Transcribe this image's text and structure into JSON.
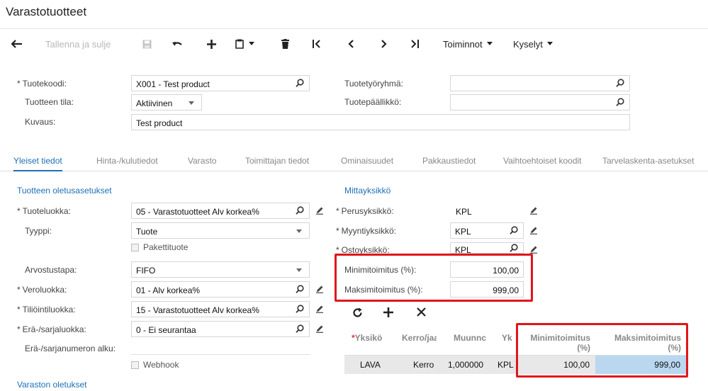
{
  "page_title": "Varastotuotteet",
  "toolbar": {
    "save_close_label": "Tallenna ja sulje",
    "actions_label": "Toiminnot",
    "queries_label": "Kyselyt"
  },
  "header": {
    "product_code_label": "Tuotekoodi:",
    "product_code_value": "X001 - Test product",
    "status_label": "Tuotteen tila:",
    "status_value": "Aktiivinen",
    "description_label": "Kuvaus:",
    "description_value": "Test product",
    "product_group_label": "Tuotetyöryhmä:",
    "product_group_value": "",
    "product_manager_label": "Tuotepäällikkö:",
    "product_manager_value": ""
  },
  "tabs": [
    {
      "label": "Yleiset tiedot",
      "active": true
    },
    {
      "label": "Hinta-/kulutiedot",
      "active": false
    },
    {
      "label": "Varasto",
      "active": false
    },
    {
      "label": "Toimittajan tiedot",
      "active": false
    },
    {
      "label": "Ominaisuudet",
      "active": false
    },
    {
      "label": "Pakkaustiedot",
      "active": false
    },
    {
      "label": "Vaihtoehtoiset koodit",
      "active": false
    },
    {
      "label": "Tarvelaskenta-asetukset",
      "active": false
    }
  ],
  "defaults": {
    "section_title": "Tuotteen oletusasetukset",
    "item_class_label": "Tuoteluokka:",
    "item_class_value": "05 - Varastotuotteet Alv korkea%",
    "type_label": "Tyyppi:",
    "type_value": "Tuote",
    "kit_label": "Pakettituote",
    "valuation_label": "Arvostustapa:",
    "valuation_value": "FIFO",
    "tax_class_label": "Veroluokka:",
    "tax_class_value": "01 - Alv korkea%",
    "posting_class_label": "Tiliöintiluokka:",
    "posting_class_value": "15 - Varastotuotteet Alv korkea%",
    "lot_class_label": "Erä-/sarjaluokka:",
    "lot_class_value": "0 - Ei seurantaa",
    "lot_start_label": "Erä-/sarjanumeron alku:",
    "webhook_label": "Webhook",
    "warehouse_section_title": "Varaston oletukset"
  },
  "uom": {
    "section_title": "Mittayksikkö",
    "base_label": "Perusyksikkö:",
    "base_value": "KPL",
    "sales_label": "Myyntiyksikkö:",
    "sales_value": "KPL",
    "purchase_label": "Ostoyksikkö:",
    "purchase_value": "KPL",
    "min_label": "Minimitoimitus (%):",
    "min_value": "100,00",
    "max_label": "Maksimitoimitus (%):",
    "max_value": "999,00"
  },
  "grid": {
    "headers": {
      "unit": "Yksikö",
      "multiply": "Kerro/jaa",
      "conversion": "Muunnc",
      "to_unit": "Yk",
      "min_l1": "Minimitoimitus",
      "min_l2": "(%)",
      "max_l1": "Maksimitoimitus",
      "max_l2": "(%)"
    },
    "row": {
      "unit": "LAVA",
      "multiply": "Kerro",
      "conversion": "1,000000",
      "to_unit": "KPL",
      "min": "100,00",
      "max": "999,00"
    }
  }
}
